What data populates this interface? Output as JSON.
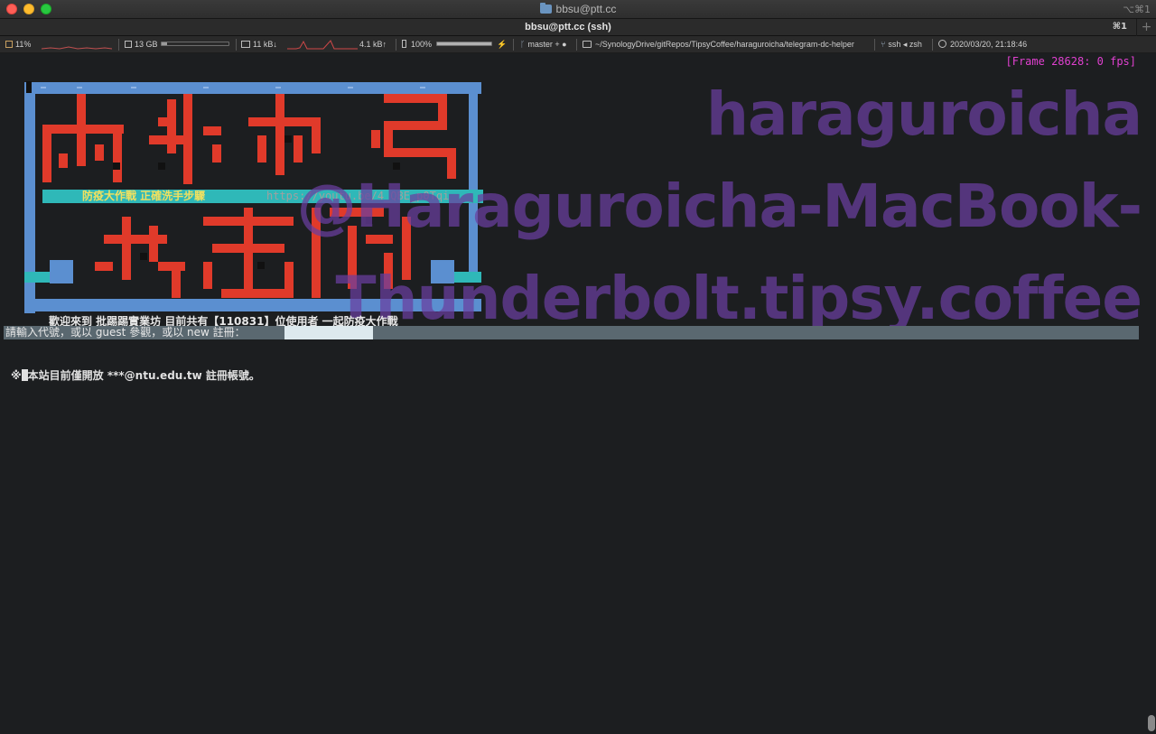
{
  "window": {
    "title": "bbsu@ptt.cc",
    "shortcut": "⌥⌘1"
  },
  "tab": {
    "label": "bbsu@ptt.cc (ssh)",
    "shortcut": "⌘1",
    "new_tab": "+"
  },
  "status_bar": {
    "cpu": "11%",
    "memory": "13 GB",
    "net_down": "11 kB↓",
    "net_up": "4.1 kB↑",
    "battery": "100%",
    "battery_charge_icon": "⚡",
    "git_branch": "master + ●",
    "path": "~/SynologyDrive/gitRepos/TipsyCoffee/haraguroicha/telegram-dc-helper",
    "job": "ssh ◂ zsh",
    "datetime": "2020/03/20, 21:18:46"
  },
  "terminal": {
    "frame_counter": "[Frame 28628: 0 fps]",
    "banner_text": "防疫大作戰 正確洗手步驟",
    "banner_url": "https://youtu.be/4_QBE_p0Tqi",
    "welcome": "歡迎來到 批踢踢實業坊 目前共有【110831】位使用者 一起防疫大作戰",
    "login_prompt": "請輸入代號，或以 guest 參觀，或以 new 註冊：",
    "login_value": "",
    "notice_prefix": "※",
    "notice_text": "本站目前僅開放 ***@ntu.edu.tw 註冊帳號。"
  },
  "watermark": {
    "line1": "haraguroicha",
    "line2": "@Haraguroicha-MacBook-",
    "line3": "Thunderbolt.tipsy.coffee"
  },
  "colors": {
    "art_red": "#e03a2a",
    "art_frame": "#5b8fd0",
    "art_teal": "#2fb8b8",
    "watermark": "#6a3fa0"
  }
}
